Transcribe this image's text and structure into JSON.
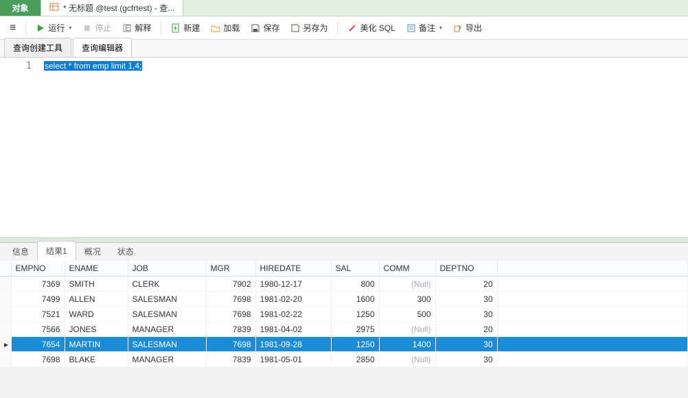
{
  "tabs": {
    "object": "对象",
    "query": "* 无标题 @test (gcfrtest) - 查..."
  },
  "toolbar": {
    "menu": "≡",
    "run": "运行",
    "stop": "停止",
    "explain": "解释",
    "new": "新建",
    "load": "加载",
    "save": "保存",
    "saveas": "另存为",
    "beautify": "美化 SQL",
    "notes": "备注",
    "export": "导出"
  },
  "subtabs": {
    "builder": "查询创建工具",
    "editor": "查询编辑器"
  },
  "editor": {
    "line": "1",
    "sql": "select * from emp limit 1,4;"
  },
  "resultTabs": {
    "msg": "信息",
    "result1": "结果1",
    "overview": "概况",
    "status": "状态"
  },
  "columns": [
    "EMPNO",
    "ENAME",
    "JOB",
    "MGR",
    "HIREDATE",
    "SAL",
    "COMM",
    "DEPTNO"
  ],
  "null_text": "(Null)",
  "rows": [
    {
      "EMPNO": 7369,
      "ENAME": "SMITH",
      "JOB": "CLERK",
      "MGR": 7902,
      "HIREDATE": "1980-12-17",
      "SAL": 800,
      "COMM": null,
      "DEPTNO": 20
    },
    {
      "EMPNO": 7499,
      "ENAME": "ALLEN",
      "JOB": "SALESMAN",
      "MGR": 7698,
      "HIREDATE": "1981-02-20",
      "SAL": 1600,
      "COMM": 300,
      "DEPTNO": 30
    },
    {
      "EMPNO": 7521,
      "ENAME": "WARD",
      "JOB": "SALESMAN",
      "MGR": 7698,
      "HIREDATE": "1981-02-22",
      "SAL": 1250,
      "COMM": 500,
      "DEPTNO": 30
    },
    {
      "EMPNO": 7566,
      "ENAME": "JONES",
      "JOB": "MANAGER",
      "MGR": 7839,
      "HIREDATE": "1981-04-02",
      "SAL": 2975,
      "COMM": null,
      "DEPTNO": 20
    },
    {
      "EMPNO": 7654,
      "ENAME": "MARTIN",
      "JOB": "SALESMAN",
      "MGR": 7698,
      "HIREDATE": "1981-09-28",
      "SAL": 1250,
      "COMM": 1400,
      "DEPTNO": 30
    },
    {
      "EMPNO": 7698,
      "ENAME": "BLAKE",
      "JOB": "MANAGER",
      "MGR": 7839,
      "HIREDATE": "1981-05-01",
      "SAL": 2850,
      "COMM": null,
      "DEPTNO": 30
    }
  ],
  "selectedRow": 4
}
